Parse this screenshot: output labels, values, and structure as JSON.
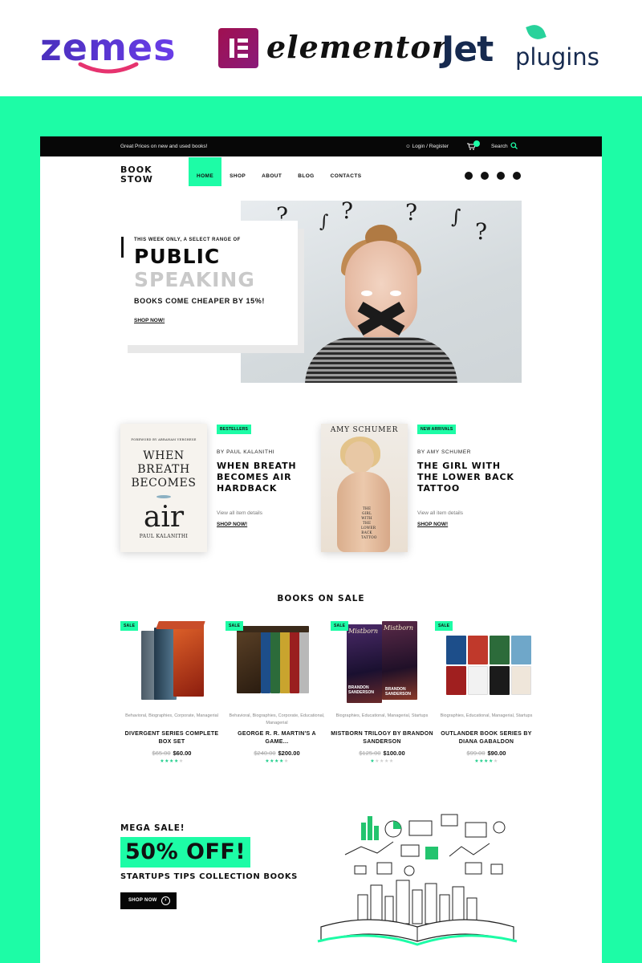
{
  "vendors": {
    "zemes": "zemes",
    "elementor": "elementor",
    "jet": "Jet",
    "jet_suffix": "plugins"
  },
  "topbar": {
    "promo": "Great Prices on new and used books!",
    "login": "Login / Register",
    "search": "Search"
  },
  "brand": {
    "line1": "BOOK",
    "line2": "STOW"
  },
  "nav": [
    {
      "label": "HOME",
      "active": true
    },
    {
      "label": "SHOP"
    },
    {
      "label": "ABOUT"
    },
    {
      "label": "BLOG"
    },
    {
      "label": "CONTACTS"
    }
  ],
  "social_icons": [
    "facebook-icon",
    "twitter-icon",
    "instagram-icon",
    "youtube-icon"
  ],
  "hero": {
    "kicker": "THIS WEEK ONLY, A SELECT RANGE OF",
    "title1": "PUBLIC",
    "title2": "SPEAKING",
    "subtitle": "BOOKS COME CHEAPER BY 15%!",
    "cta": "SHOP NOW!"
  },
  "featured": [
    {
      "badge": "BESTELLERS",
      "by": "BY PAUL KALANITHI",
      "title": "WHEN BREATH BECOMES AIR HARDBACK",
      "view": "View all item details",
      "cta": "SHOP NOW!",
      "cover": {
        "foreword": "FOREWORD BY ABRAHAM VERGHESE",
        "line1": "WHEN",
        "line2": "BREATH",
        "line3": "BECOMES",
        "line4": "air",
        "author": "PAUL KALANITHI"
      }
    },
    {
      "badge": "NEW ARRIVALS",
      "by": "BY AMY SCHUMER",
      "title": "THE GIRL WITH THE LOWER BACK TATTOO",
      "view": "View all item details",
      "cta": "SHOP NOW!",
      "cover": {
        "author": "AMY SCHUMER",
        "vertical": "THE GIRL WITH THE LOWER BACK TATTOO"
      }
    }
  ],
  "sale_section": {
    "heading": "BOOKS ON SALE",
    "badge": "SALE",
    "products": [
      {
        "cats": "Behavioral, Biographies, Corporate, Managerial",
        "name": "DIVERGENT SERIES COMPLETE BOX SET",
        "old": "$65.00",
        "price": "$60.00",
        "rating": 4
      },
      {
        "cats": "Behavioral, Biographies, Corporate, Educational, Managerial",
        "name": "GEORGE R. R. MARTIN'S A GAME...",
        "old": "$240.00",
        "price": "$200.00",
        "rating": 4
      },
      {
        "cats": "Biographies, Educational, Managerial, Startups",
        "name": "MISTBORN TRILOGY BY BRANDON SANDERSON",
        "old": "$125.00",
        "price": "$100.00",
        "rating": 1
      },
      {
        "cats": "Biographies, Educational, Managerial, Startups",
        "name": "OUTLANDER BOOK SERIES BY DIANA GABALDON",
        "old": "$99.00",
        "price": "$90.00",
        "rating": 4
      }
    ],
    "cover_text": {
      "mistborn": "Mistborn",
      "author1": "BRANDON",
      "author2": "SANDERSON"
    }
  },
  "mega": {
    "kicker": "MEGA SALE!",
    "offer": "50% OFF!",
    "subtitle": "STARTUPS TIPS COLLECTION BOOKS",
    "cta": "SHOP NOW"
  },
  "colors": {
    "accent": "#1dfca6",
    "dark": "#070707",
    "zemes": "#4a2fbd",
    "elementor": "#93003c",
    "jet": "#162a4f"
  }
}
